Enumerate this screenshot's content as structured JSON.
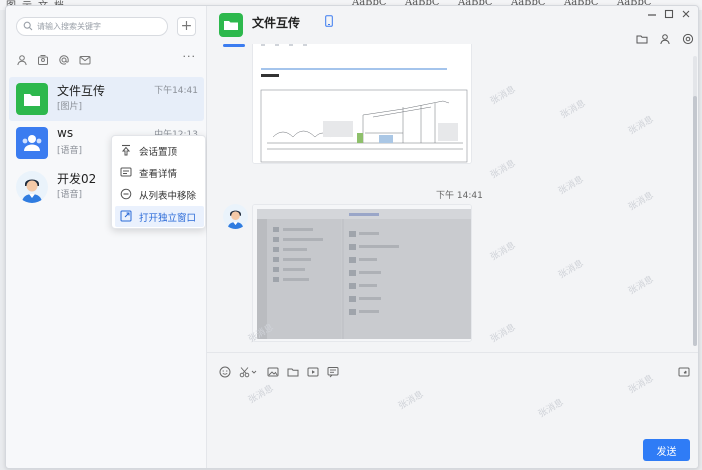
{
  "window": {
    "title": "文件互传"
  },
  "desktop_strip": [
    "图",
    "示",
    "文",
    "档",
    "AaBbC",
    "AaBbC",
    "AaBbC",
    "AaBbC",
    "AaBbC",
    "AaBbC"
  ],
  "sidebar": {
    "search_placeholder": "请输入搜索关键字",
    "add_label": "+",
    "filters": [
      "person-icon",
      "group-icon",
      "at-icon",
      "mail-icon"
    ],
    "more_label": "···",
    "conversations": [
      {
        "name": "文件互传",
        "sub": "[图片]",
        "time": "下午14:41",
        "avatar": "folder-avatar",
        "active": true
      },
      {
        "name": "ws",
        "sub": "[语音]",
        "time": "中午12:13",
        "avatar": "group-avatar",
        "active": false
      },
      {
        "name": "开发02",
        "sub": "[语音]",
        "time": "",
        "avatar": "person-avatar",
        "active": false
      }
    ]
  },
  "context_menu": {
    "items": [
      {
        "label": "会话置顶",
        "icon": "pin-top-icon"
      },
      {
        "label": "查看详情",
        "icon": "details-icon"
      },
      {
        "label": "从列表中移除",
        "icon": "remove-circle-icon"
      },
      {
        "label": "打开独立窗口",
        "icon": "open-window-icon",
        "highlighted": true
      }
    ]
  },
  "chat": {
    "title": "文件互传",
    "messages": [
      {
        "type": "image",
        "content": "architectural-drawing"
      },
      {
        "time": "下午 14:41"
      },
      {
        "type": "image",
        "content": "app-screenshot"
      }
    ],
    "watermark": "张消息",
    "send_label": "发送"
  },
  "colors": {
    "accent": "#2f7cf6",
    "folder_green": "#2db84d",
    "active_row": "#e7eef9"
  }
}
